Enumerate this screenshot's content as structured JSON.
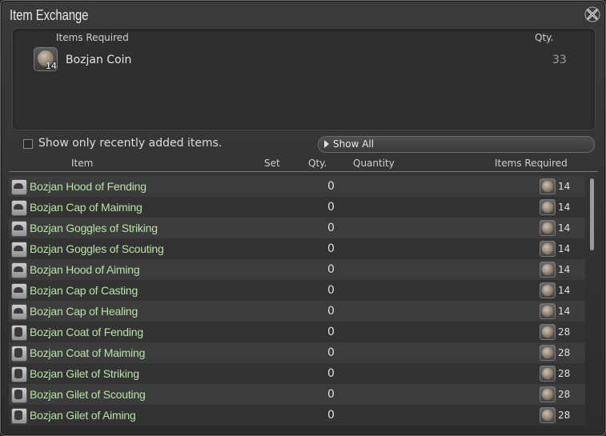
{
  "window": {
    "title": "Item Exchange"
  },
  "requirements": {
    "header_items": "Items Required",
    "header_qty": "Qty.",
    "item": {
      "name": "Bozjan Coin",
      "icon": "coin-icon",
      "count": "14",
      "qty": "33"
    }
  },
  "filter": {
    "label": "Show only recently added items.",
    "checked": false
  },
  "dropdown": {
    "label": "Show All"
  },
  "columns": {
    "item": "Item",
    "set": "Set",
    "qty": "Qty.",
    "quantity": "Quantity",
    "required": "Items Required"
  },
  "rows": [
    {
      "name": "Bozjan Hood of Fending",
      "icon": "head-icon",
      "qty": "0",
      "cost": "14"
    },
    {
      "name": "Bozjan Cap of Maiming",
      "icon": "head-icon",
      "qty": "0",
      "cost": "14"
    },
    {
      "name": "Bozjan Goggles of Striking",
      "icon": "head-icon",
      "qty": "0",
      "cost": "14"
    },
    {
      "name": "Bozjan Goggles of Scouting",
      "icon": "head-icon",
      "qty": "0",
      "cost": "14"
    },
    {
      "name": "Bozjan Hood of Aiming",
      "icon": "head-icon",
      "qty": "0",
      "cost": "14"
    },
    {
      "name": "Bozjan Cap of Casting",
      "icon": "head-icon",
      "qty": "0",
      "cost": "14"
    },
    {
      "name": "Bozjan Cap of Healing",
      "icon": "head-icon",
      "qty": "0",
      "cost": "14"
    },
    {
      "name": "Bozjan Coat of Fending",
      "icon": "body-icon",
      "qty": "0",
      "cost": "28"
    },
    {
      "name": "Bozjan Coat of Maiming",
      "icon": "body-icon",
      "qty": "0",
      "cost": "28"
    },
    {
      "name": "Bozjan Gilet of Striking",
      "icon": "body-icon",
      "qty": "0",
      "cost": "28"
    },
    {
      "name": "Bozjan Gilet of Scouting",
      "icon": "body-icon",
      "qty": "0",
      "cost": "28"
    },
    {
      "name": "Bozjan Gilet of Aiming",
      "icon": "body-icon",
      "qty": "0",
      "cost": "28"
    }
  ]
}
